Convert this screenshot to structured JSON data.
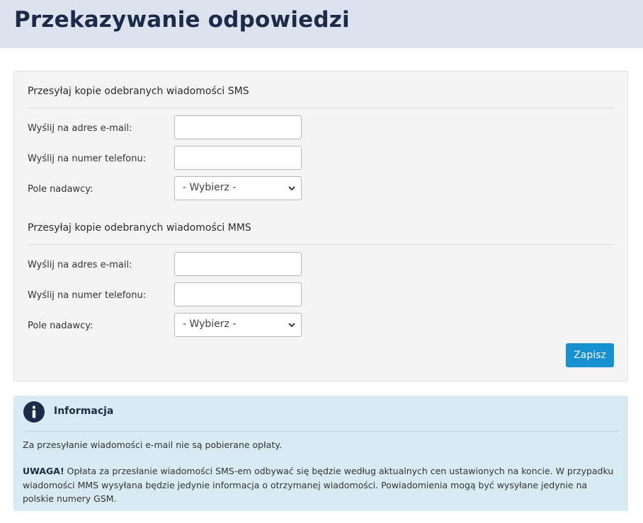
{
  "page": {
    "title": "Przekazywanie odpowiedzi"
  },
  "sms": {
    "section_title": "Przesyłaj kopie odebranych wiadomości SMS",
    "email_label": "Wyślij na adres e-mail:",
    "email_value": "",
    "phone_label": "Wyślij na numer telefonu:",
    "phone_value": "",
    "sender_label": "Pole nadawcy:",
    "sender_selected": "- Wybierz -"
  },
  "mms": {
    "section_title": "Przesyłaj kopie odebranych wiadomości MMS",
    "email_label": "Wyślij na adres e-mail:",
    "email_value": "",
    "phone_label": "Wyślij na numer telefonu:",
    "phone_value": "",
    "sender_label": "Pole nadawcy:",
    "sender_selected": "- Wybierz -"
  },
  "actions": {
    "save_label": "Zapisz"
  },
  "info": {
    "title": "Informacja",
    "icon": "info-icon",
    "line1": "Za przesyłanie wiadomości e-mail nie są pobierane opłaty.",
    "warning_prefix": "UWAGA!",
    "warning_text": " Opłata za przesłanie wiadomości SMS-em odbywać się będzie według aktualnych cen ustawionych na koncie. W przypadku wiadomości MMS wysyłana będzie jedynie informacja o otrzymanej wiadomości. Powiadomienia mogą być wysyłane jedynie na polskie numery GSM."
  },
  "colors": {
    "header_bg": "#dde3ee",
    "title": "#1c2b4a",
    "accent": "#1690d0",
    "info_bg": "#d8ebf5"
  }
}
